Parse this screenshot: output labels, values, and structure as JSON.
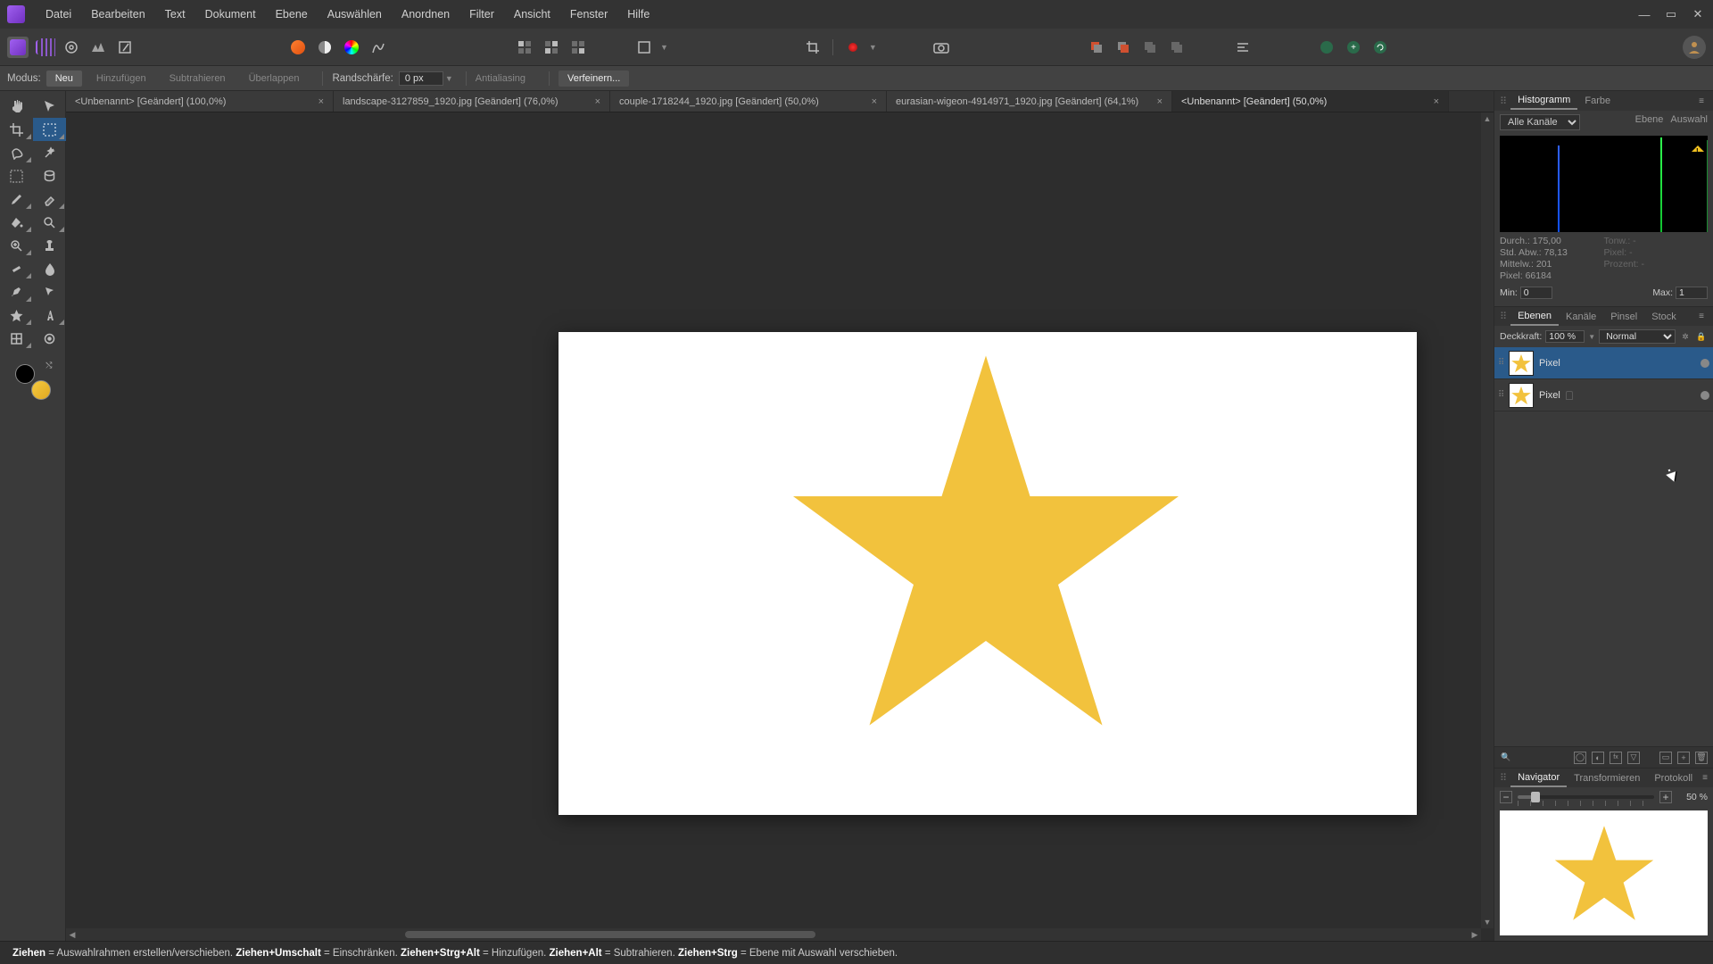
{
  "menu": {
    "items": [
      "Datei",
      "Bearbeiten",
      "Text",
      "Dokument",
      "Ebene",
      "Auswählen",
      "Anordnen",
      "Filter",
      "Ansicht",
      "Fenster",
      "Hilfe"
    ]
  },
  "contextbar": {
    "mode_label": "Modus:",
    "mode_new": "Neu",
    "mode_add": "Hinzufügen",
    "mode_sub": "Subtrahieren",
    "mode_overlap": "Überlappen",
    "feather_label": "Randschärfe:",
    "feather_value": "0 px",
    "antialias": "Antialiasing",
    "refine": "Verfeinern..."
  },
  "tabs": [
    {
      "label": "<Unbenannt> [Geändert] (100,0%)",
      "active": false
    },
    {
      "label": "landscape-3127859_1920.jpg [Geändert] (76,0%)",
      "active": false
    },
    {
      "label": "couple-1718244_1920.jpg [Geändert] (50,0%)",
      "active": false
    },
    {
      "label": "eurasian-wigeon-4914971_1920.jpg [Geändert] (64,1%)",
      "active": false
    },
    {
      "label": "<Unbenannt> [Geändert] (50,0%)",
      "active": true
    }
  ],
  "panels": {
    "hist_tab": "Histogramm",
    "color_tab": "Farbe",
    "channel_select": "Alle Kanäle",
    "hist_btn_layer": "Ebene",
    "hist_btn_sel": "Auswahl",
    "stats": {
      "durch": "Durch.: 175,00",
      "std": "Std. Abw.: 78,13",
      "mittelw": "Mittelw.: 201",
      "pixel": "Pixel: 66184",
      "tonw": "Tonw.: -",
      "pixel2": "Pixel: -",
      "prozent": "Prozent: -"
    },
    "min_label": "Min:",
    "min_value": "0",
    "max_label": "Max:",
    "max_value": "1",
    "layers_tab": "Ebenen",
    "channels_tab": "Kanäle",
    "brushes_tab": "Pinsel",
    "stock_tab": "Stock",
    "opacity_label": "Deckkraft:",
    "opacity_value": "100 %",
    "blend_mode": "Normal",
    "layers": [
      {
        "name": "Pixel",
        "selected": true
      },
      {
        "name": "Pixel",
        "selected": false
      }
    ],
    "nav_tab": "Navigator",
    "transform_tab": "Transformieren",
    "history_tab": "Protokoll",
    "zoom_value": "50 %"
  },
  "status": {
    "s1a": "Ziehen",
    "s1b": " = Auswahlrahmen erstellen/verschieben. ",
    "s2a": "Ziehen+Umschalt",
    "s2b": " = Einschränken. ",
    "s3a": "Ziehen+Strg+Alt",
    "s3b": " = Hinzufügen. ",
    "s4a": "Ziehen+Alt",
    "s4b": " = Subtrahieren. ",
    "s5a": "Ziehen+Strg",
    "s5b": " = Ebene mit Auswahl verschieben."
  }
}
